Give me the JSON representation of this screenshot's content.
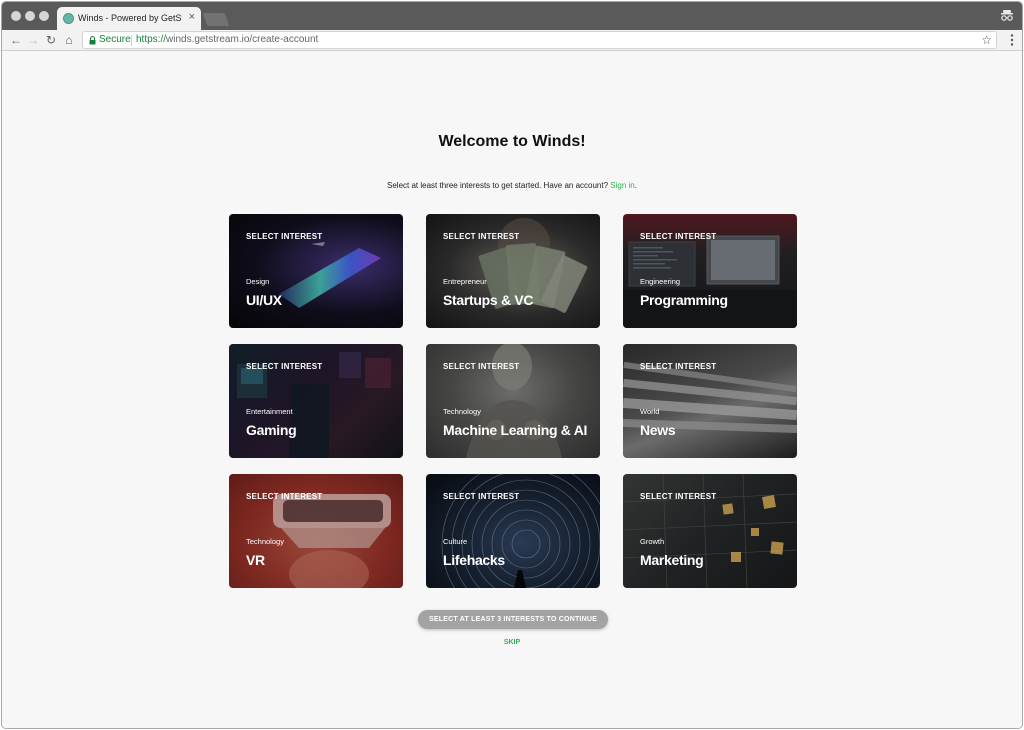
{
  "browser": {
    "tab_title": "Winds - Powered by GetStream",
    "tab_close": "×",
    "secure_label": "Secure",
    "url_scheme": "https://",
    "url_rest": "winds.getstream.io/create-account"
  },
  "page": {
    "heading": "Welcome to Winds!",
    "subtitle_text": "Select at least three interests to get started. Have an account?",
    "signin_link": "Sign in",
    "subtitle_end": ".",
    "interests": [
      {
        "select": "SELECT INTEREST",
        "category": "Design",
        "title": "UI/UX"
      },
      {
        "select": "SELECT INTEREST",
        "category": "Entrepreneur",
        "title": "Startups & VC"
      },
      {
        "select": "SELECT INTEREST",
        "category": "Engineering",
        "title": "Programming"
      },
      {
        "select": "SELECT INTEREST",
        "category": "Entertainment",
        "title": "Gaming"
      },
      {
        "select": "SELECT INTEREST",
        "category": "Technology",
        "title": "Machine Learning & AI"
      },
      {
        "select": "SELECT INTEREST",
        "category": "World",
        "title": "News"
      },
      {
        "select": "SELECT INTEREST",
        "category": "Technology",
        "title": "VR"
      },
      {
        "select": "SELECT INTEREST",
        "category": "Culture",
        "title": "Lifehacks"
      },
      {
        "select": "SELECT INTEREST",
        "category": "Growth",
        "title": "Marketing"
      }
    ],
    "continue_label": "SELECT AT LEAST 3 INTERESTS TO CONTINUE",
    "skip_label": "SKIP"
  },
  "colors": {
    "accent_green": "#2fb157",
    "button_disabled": "#a3a3a3",
    "page_bg": "#f7f7f7"
  }
}
